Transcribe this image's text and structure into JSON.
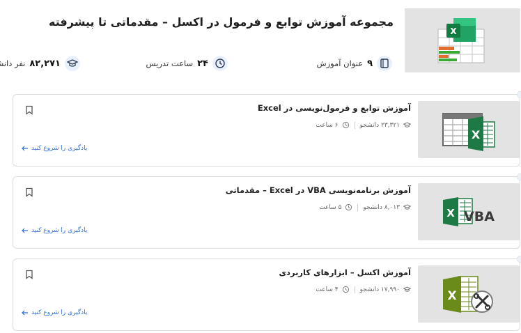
{
  "header": {
    "title": "مجموعه آموزش توابع و فرمول در اکسل – مقدماتی تا پیشرفته",
    "image_icon": "excel-grid-chart-icon"
  },
  "stats": {
    "courses": {
      "value": "۹",
      "label": "عنوان آموزش",
      "icon": "book-icon"
    },
    "hours": {
      "value": "۲۴",
      "label": "ساعت تدریس",
      "icon": "clock-icon"
    },
    "students": {
      "value": "۸۲,۲۷۱",
      "label": "نفر دانشجو",
      "icon": "graduation-cap-icon"
    }
  },
  "courses": [
    {
      "title": "آموزش توابع و فرمول‌نویسی در Excel",
      "students": "۲۳,۳۲۱ دانشجو",
      "duration": "۶ ساعت",
      "start_label": "یادگیری را شروع کنید",
      "thumb_icon": "excel-sheet-icon"
    },
    {
      "title": "آموزش برنامه‌نویسی VBA در Excel – مقدماتی",
      "students": "۸,۰۱۳ دانشجو",
      "duration": "۵ ساعت",
      "start_label": "یادگیری را شروع کنید",
      "thumb_icon": "excel-vba-icon",
      "thumb_text": "VBA"
    },
    {
      "title": "آموزش اکسل – ابزارهای کاربردی",
      "students": "۱۷,۹۹۰ دانشجو",
      "duration": "۴ ساعت",
      "start_label": "یادگیری را شروع کنید",
      "thumb_icon": "excel-tools-icon"
    }
  ],
  "colors": {
    "excel_green": "#1d7a45",
    "accent_blue": "#2f6fd1"
  }
}
